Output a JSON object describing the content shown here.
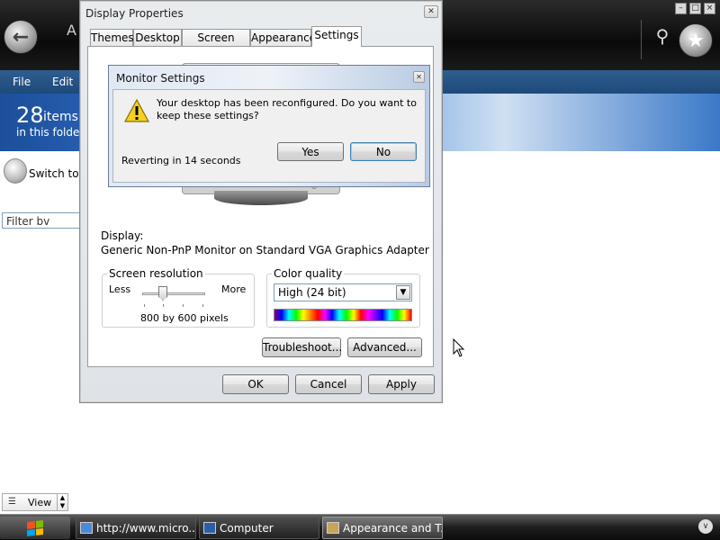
{
  "background_window": {
    "title": "A",
    "menu": [
      "File",
      "Edit"
    ],
    "item_count": "28",
    "items_label": "items",
    "folder_label": "in this folder",
    "switch_label": "Switch to C",
    "filter_value": "Filter bv",
    "view_label": "View"
  },
  "display_properties": {
    "title": "Display Properties",
    "tabs": [
      "Themes",
      "Desktop",
      "Screen Saver",
      "Appearance",
      "Settings"
    ],
    "selected_tab": "Settings",
    "display_label": "Display:",
    "display_value": "Generic Non-PnP Monitor on Standard VGA Graphics Adapter",
    "screen_resolution": {
      "legend": "Screen resolution",
      "less": "Less",
      "more": "More",
      "value": "800 by 600 pixels"
    },
    "color_quality": {
      "legend": "Color quality",
      "selected": "High (24 bit)"
    },
    "troubleshoot_button": "Troubleshoot...",
    "advanced_button": "Advanced...",
    "ok_button": "OK",
    "cancel_button": "Cancel",
    "apply_button": "Apply"
  },
  "monitor_settings": {
    "title": "Monitor Settings",
    "message": "Your desktop has been reconfigured.  Do you want to keep these settings?",
    "reverting": "Reverting in 14 seconds",
    "yes_button": "Yes",
    "no_button": "No"
  },
  "taskbar": {
    "tasks": [
      "http://www.micro...",
      "Computer",
      "Appearance and T..."
    ]
  }
}
